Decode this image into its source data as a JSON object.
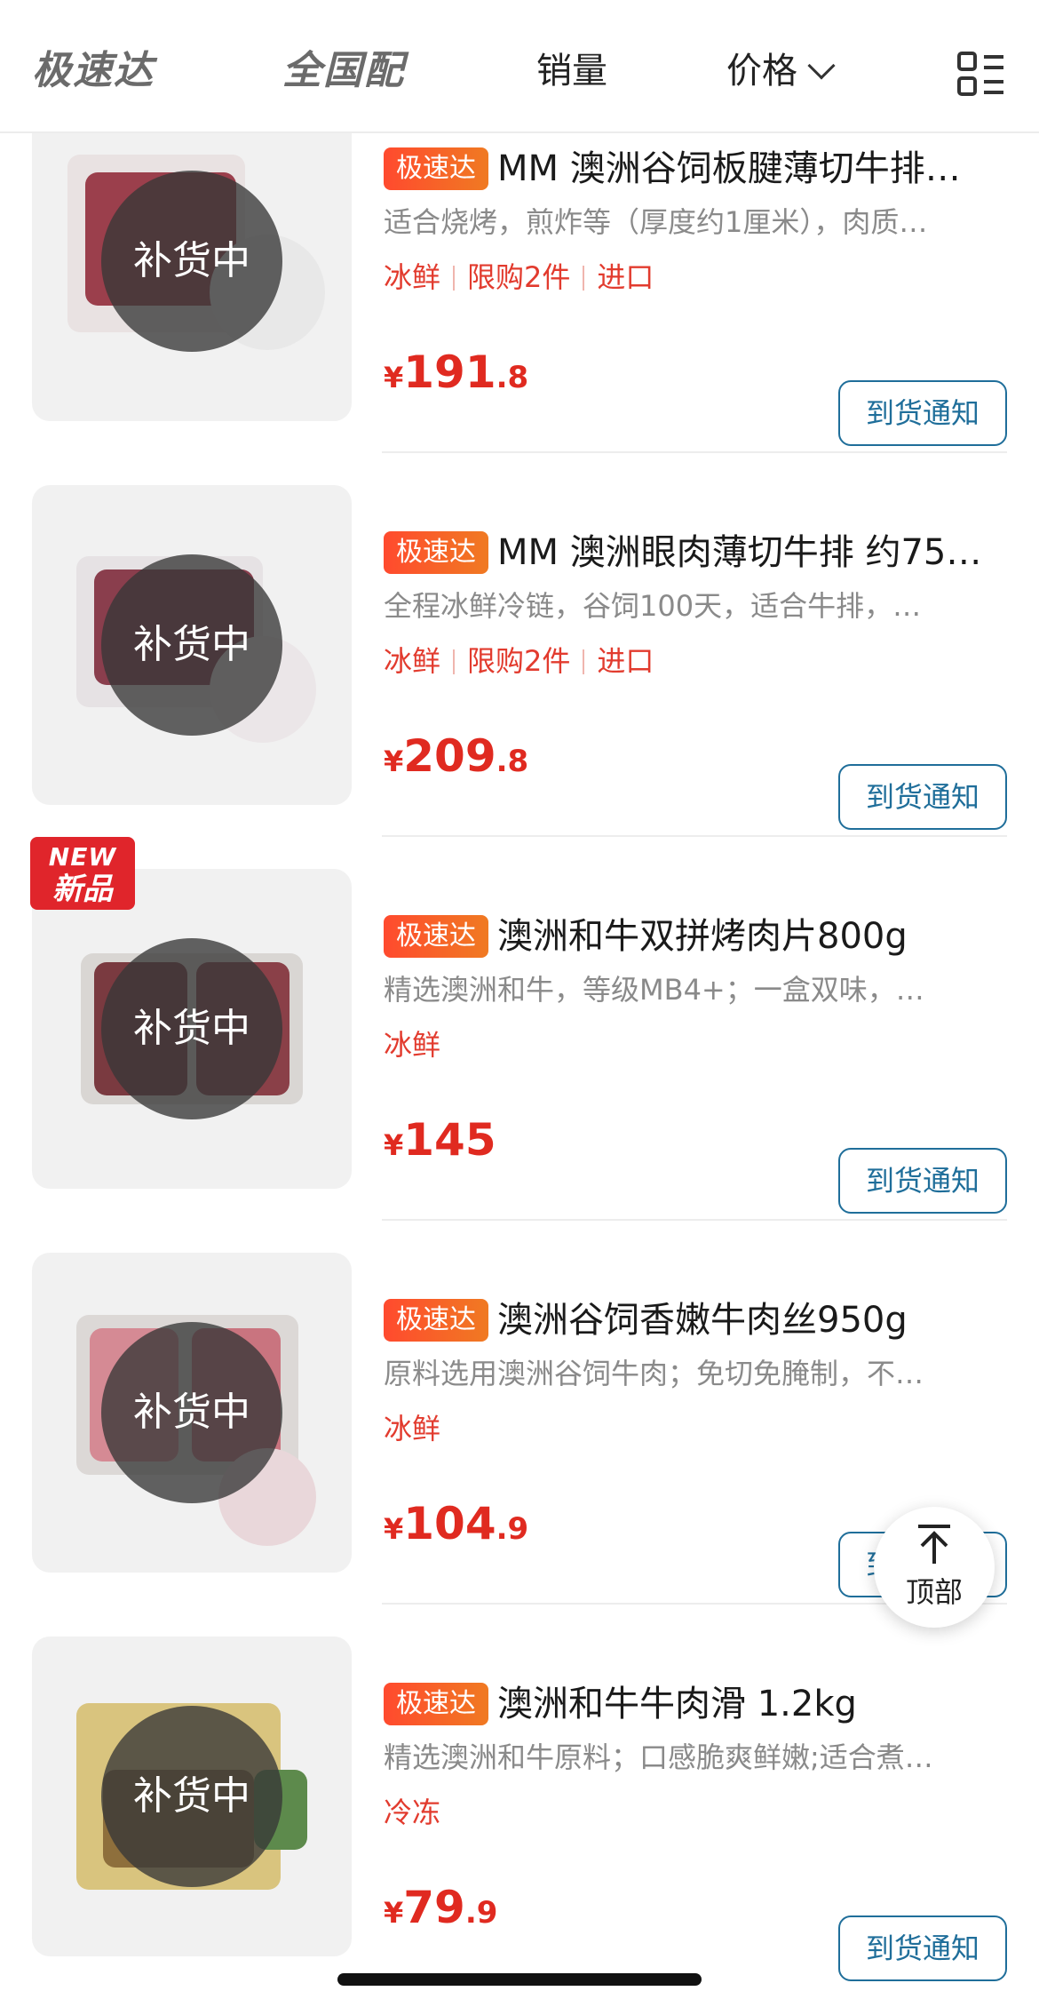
{
  "tabs": [
    {
      "label": "极速达"
    },
    {
      "label": "全国配"
    },
    {
      "label": "销量"
    },
    {
      "label": "价格"
    }
  ],
  "restock_overlay": "补货中",
  "products": [
    {
      "badge": "极速达",
      "title": "MM 澳洲谷饲板腱薄切牛排…",
      "desc": "适合烧烤，煎炸等（厚度约1厘米），肉质…",
      "tags": [
        "冰鲜",
        "限购2件",
        "进口"
      ],
      "price_currency": "¥",
      "price_int": "191",
      "price_dec": ".8",
      "button": "到货通知"
    },
    {
      "badge": "极速达",
      "title": "MM 澳洲眼肉薄切牛排 约75…",
      "desc": "全程冰鲜冷链，谷饲100天，适合牛排，…",
      "tags": [
        "冰鲜",
        "限购2件",
        "进口"
      ],
      "price_currency": "¥",
      "price_int": "209",
      "price_dec": ".8",
      "button": "到货通知"
    },
    {
      "badge": "极速达",
      "new_badge_en": "NEW",
      "new_badge_cn": "新品",
      "title": "澳洲和牛双拼烤肉片800g",
      "desc": "精选澳洲和牛，等级MB4+；一盒双味，…",
      "tags": [
        "冰鲜"
      ],
      "price_currency": "¥",
      "price_int": "145",
      "price_dec": "",
      "button": "到货通知"
    },
    {
      "badge": "极速达",
      "title": "澳洲谷饲香嫩牛肉丝950g",
      "desc": "原料选用澳洲谷饲牛肉；免切免腌制，不…",
      "tags": [
        "冰鲜"
      ],
      "price_currency": "¥",
      "price_int": "104",
      "price_dec": ".9",
      "button": "到货通知"
    },
    {
      "badge": "极速达",
      "title": "澳洲和牛牛肉滑 1.2kg",
      "desc": "精选澳洲和牛原料；口感脆爽鲜嫩;适合煮…",
      "tags": [
        "冷冻"
      ],
      "price_currency": "¥",
      "price_int": "79",
      "price_dec": ".9",
      "button": "到货通知"
    }
  ],
  "back_to_top": "顶部",
  "colors": {
    "price": "#e02a20",
    "badge_start": "#ff4a2e",
    "badge_end": "#f07a22",
    "button_border": "#1f6e9a",
    "tag": "#e23b2e"
  }
}
